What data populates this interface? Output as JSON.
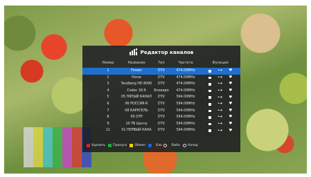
{
  "dialog": {
    "title": "Редактор каналов",
    "icon": "channel-editor-icon",
    "headers": {
      "number": "Номер",
      "name": "Название",
      "type": "Тип",
      "frequency": "Частота",
      "function": "Функция"
    },
    "selected_color": "#1f6fd1",
    "channels": [
      {
        "number": "1",
        "name": "Flower",
        "type": "DTV",
        "frequency": "474.00MHz",
        "selected": true
      },
      {
        "number": "2",
        "name": "Horse",
        "type": "DTV",
        "frequency": "474.00MHz"
      },
      {
        "number": "3",
        "name": "Tandberg HD 8090",
        "type": "DTV",
        "frequency": "474.00MHz"
      },
      {
        "number": "4",
        "name": "Codec 16:9",
        "type": "Блокиро",
        "frequency": "474.00MHz"
      },
      {
        "number": "5",
        "name": "05 ПЯТЫЙ КАНАЛ",
        "type": "DTV",
        "frequency": "594.00MHz"
      },
      {
        "number": "6",
        "name": "06 РОССИЯ-К",
        "type": "DTV",
        "frequency": "594.00MHz"
      },
      {
        "number": "7",
        "name": "08 КАРУСЕЛЬ",
        "type": "DTV",
        "frequency": "594.00MHz"
      },
      {
        "number": "8",
        "name": "09 ОТР",
        "type": "DTV",
        "frequency": "594.00MHz"
      },
      {
        "number": "9",
        "name": "10 ТВ Центр",
        "type": "DTV",
        "frequency": "594.00MHz"
      },
      {
        "number": "11",
        "name": "01 ПЕРВЫЙ КАНА",
        "type": "DTV",
        "frequency": "594.00MHz"
      }
    ],
    "footer": {
      "delete": {
        "label": "Удалить",
        "color": "#e02020"
      },
      "skip": {
        "label": "Пропуск",
        "color": "#1fa83a"
      },
      "swap": {
        "label": "Обмен",
        "color": "#f0d000"
      },
      "blue": {
        "label": "",
        "color": "#1f5fd8"
      },
      "fav": {
        "label": "Бло"
      },
      "info": {
        "label": "Любо"
      },
      "back": {
        "label": "Назад"
      }
    }
  },
  "background": {
    "color_bars": [
      "#d8d8d8",
      "#e0d84a",
      "#4ac8c8",
      "#3bb44a",
      "#c846c8",
      "#d83a3a",
      "#3a46c8"
    ]
  }
}
